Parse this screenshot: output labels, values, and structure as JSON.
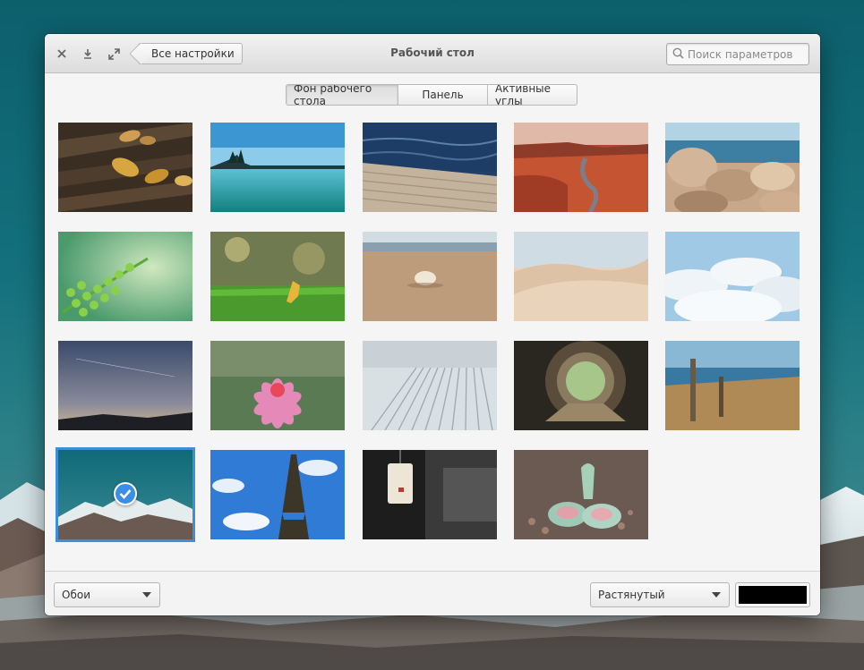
{
  "window": {
    "title": "Рабочий стол"
  },
  "titlebar": {
    "close_icon": "close-icon",
    "download_icon": "download-icon",
    "maximize_icon": "maximize-icon",
    "back_label": "Все настройки"
  },
  "search": {
    "placeholder": "Поиск параметров",
    "icon": "search-icon"
  },
  "tabs": [
    {
      "label": "Фон рабочего стола",
      "active": true
    },
    {
      "label": "Панель",
      "active": false
    },
    {
      "label": "Активные углы",
      "active": false
    }
  ],
  "wallpapers": [
    {
      "name": "autumn-leaves-on-wood"
    },
    {
      "name": "turquoise-lake"
    },
    {
      "name": "wooden-pier-sea"
    },
    {
      "name": "red-canyon"
    },
    {
      "name": "coastal-rocks"
    },
    {
      "name": "green-fern"
    },
    {
      "name": "leaf-on-grass"
    },
    {
      "name": "shell-on-sand"
    },
    {
      "name": "sand-dunes"
    },
    {
      "name": "clouds-from-above"
    },
    {
      "name": "dusk-sky"
    },
    {
      "name": "pink-lotus"
    },
    {
      "name": "metal-grating"
    },
    {
      "name": "wooden-tunnel"
    },
    {
      "name": "coast-fence-posts"
    },
    {
      "name": "snowy-mountains",
      "selected": true
    },
    {
      "name": "eiffel-tower"
    },
    {
      "name": "paper-lantern"
    },
    {
      "name": "succulent-plant"
    }
  ],
  "footer": {
    "source_value": "Обои",
    "scaling_value": "Растянутый",
    "color_value": "#000000"
  },
  "colors": {
    "accent": "#3a8ee6"
  }
}
